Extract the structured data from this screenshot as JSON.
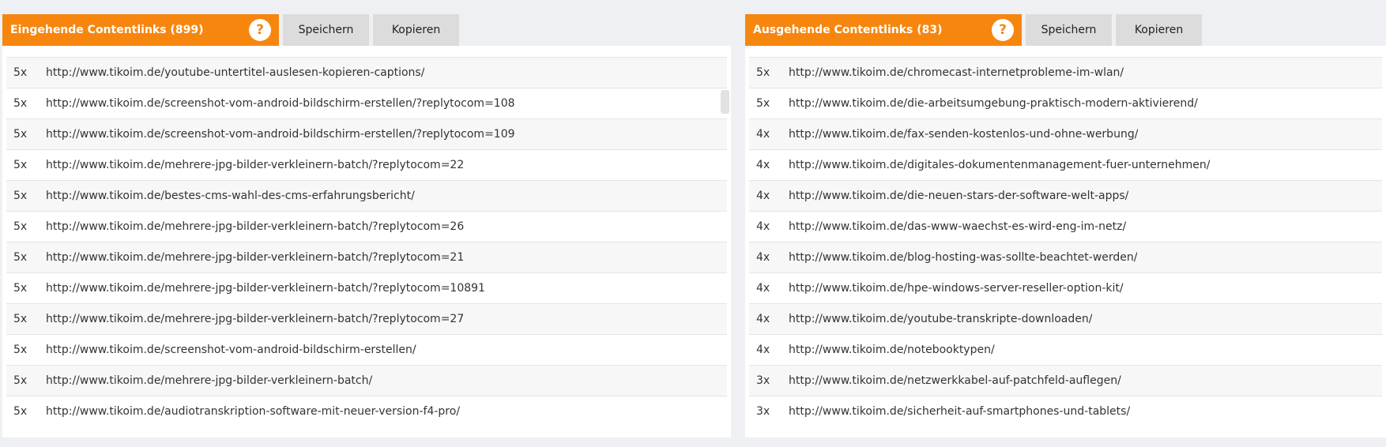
{
  "incoming": {
    "title": "Eingehende Contentlinks (899)",
    "help": "?",
    "save_label": "Speichern",
    "copy_label": "Kopieren",
    "rows": [
      {
        "count": "5x",
        "url": "http://www.tikoim.de/youtube-untertitel-auslesen-kopieren-captions/"
      },
      {
        "count": "5x",
        "url": "http://www.tikoim.de/screenshot-vom-android-bildschirm-erstellen/?replytocom=108"
      },
      {
        "count": "5x",
        "url": "http://www.tikoim.de/screenshot-vom-android-bildschirm-erstellen/?replytocom=109"
      },
      {
        "count": "5x",
        "url": "http://www.tikoim.de/mehrere-jpg-bilder-verkleinern-batch/?replytocom=22"
      },
      {
        "count": "5x",
        "url": "http://www.tikoim.de/bestes-cms-wahl-des-cms-erfahrungsbericht/"
      },
      {
        "count": "5x",
        "url": "http://www.tikoim.de/mehrere-jpg-bilder-verkleinern-batch/?replytocom=26"
      },
      {
        "count": "5x",
        "url": "http://www.tikoim.de/mehrere-jpg-bilder-verkleinern-batch/?replytocom=21"
      },
      {
        "count": "5x",
        "url": "http://www.tikoim.de/mehrere-jpg-bilder-verkleinern-batch/?replytocom=10891"
      },
      {
        "count": "5x",
        "url": "http://www.tikoim.de/mehrere-jpg-bilder-verkleinern-batch/?replytocom=27"
      },
      {
        "count": "5x",
        "url": "http://www.tikoim.de/screenshot-vom-android-bildschirm-erstellen/"
      },
      {
        "count": "5x",
        "url": "http://www.tikoim.de/mehrere-jpg-bilder-verkleinern-batch/"
      },
      {
        "count": "5x",
        "url": "http://www.tikoim.de/audiotranskription-software-mit-neuer-version-f4-pro/"
      }
    ]
  },
  "outgoing": {
    "title": "Ausgehende Contentlinks (83)",
    "help": "?",
    "save_label": "Speichern",
    "copy_label": "Kopieren",
    "rows": [
      {
        "count": "5x",
        "url": "http://www.tikoim.de/chromecast-internetprobleme-im-wlan/"
      },
      {
        "count": "5x",
        "url": "http://www.tikoim.de/die-arbeitsumgebung-praktisch-modern-aktivierend/"
      },
      {
        "count": "4x",
        "url": "http://www.tikoim.de/fax-senden-kostenlos-und-ohne-werbung/"
      },
      {
        "count": "4x",
        "url": "http://www.tikoim.de/digitales-dokumentenmanagement-fuer-unternehmen/"
      },
      {
        "count": "4x",
        "url": "http://www.tikoim.de/die-neuen-stars-der-software-welt-apps/"
      },
      {
        "count": "4x",
        "url": "http://www.tikoim.de/das-www-waechst-es-wird-eng-im-netz/"
      },
      {
        "count": "4x",
        "url": "http://www.tikoim.de/blog-hosting-was-sollte-beachtet-werden/"
      },
      {
        "count": "4x",
        "url": "http://www.tikoim.de/hpe-windows-server-reseller-option-kit/"
      },
      {
        "count": "4x",
        "url": "http://www.tikoim.de/youtube-transkripte-downloaden/"
      },
      {
        "count": "4x",
        "url": "http://www.tikoim.de/notebooktypen/"
      },
      {
        "count": "3x",
        "url": "http://www.tikoim.de/netzwerkkabel-auf-patchfeld-auflegen/"
      },
      {
        "count": "3x",
        "url": "http://www.tikoim.de/sicherheit-auf-smartphones-und-tablets/"
      }
    ]
  }
}
